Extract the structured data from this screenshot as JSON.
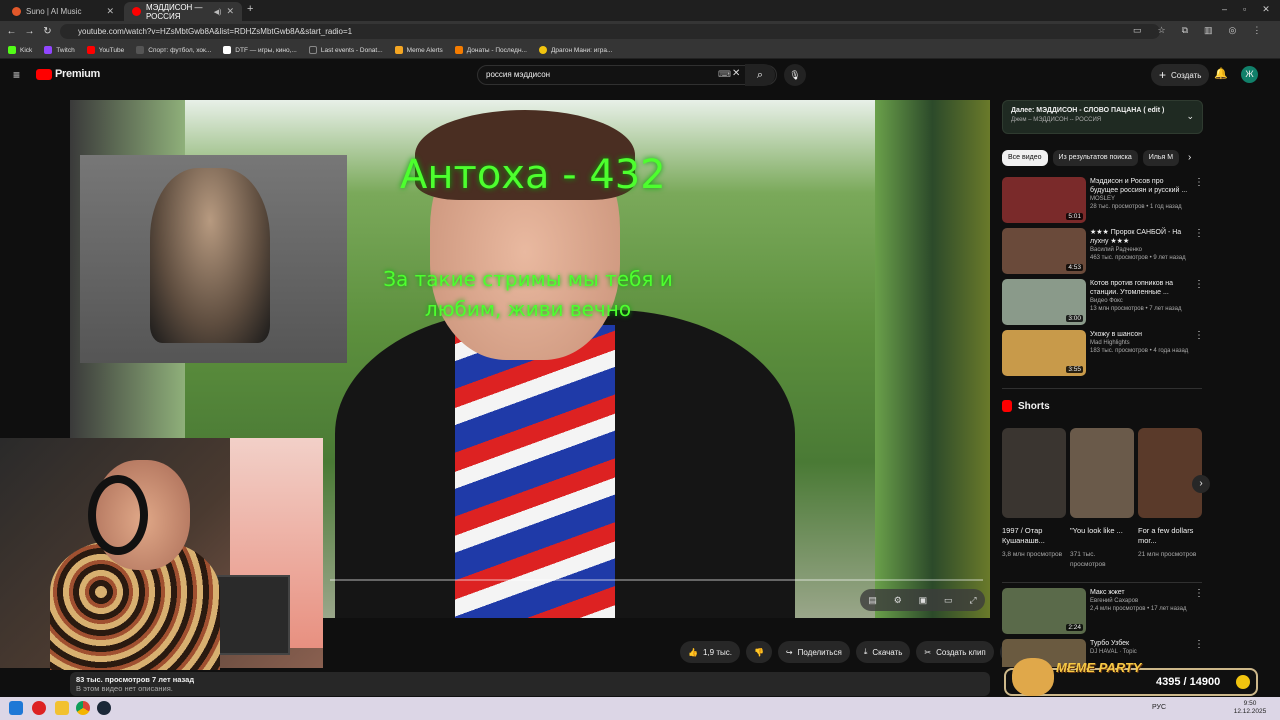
{
  "browser": {
    "tabs": [
      {
        "title": "Suno | AI Music",
        "color": "#e2582a"
      },
      {
        "title": "МЭДДИСОН — РОССИЯ",
        "color": "#ff0000"
      }
    ],
    "url": "youtube.com/watch?v=HZsMbtGwb8A&list=RDHZsMbtGwb8A&start_radio=1",
    "bookmarks": [
      {
        "label": "Kick",
        "color": "#53fc18"
      },
      {
        "label": "Twitch",
        "color": "#9146ff"
      },
      {
        "label": "YouTube",
        "color": "#ff0000"
      },
      {
        "label": "Спорт: футбол, хок...",
        "color": "#555555"
      },
      {
        "label": "DTF — игры, кино,...",
        "color": "#ffffff"
      },
      {
        "label": "Last events - Donat...",
        "color": "#333333"
      },
      {
        "label": "Meme Alerts",
        "color": "#f5a623"
      },
      {
        "label": "Донаты - Последн...",
        "color": "#f57c00"
      },
      {
        "label": "Драгон Мани: игра...",
        "color": "#f1c40f"
      }
    ]
  },
  "header": {
    "logo": "Premium",
    "search_value": "россия мэддисон",
    "create_label": "Создать",
    "avatar_letter": "Ж",
    "accent": "#ff0000"
  },
  "video": {
    "overlay_title": "Антоха - 432",
    "overlay_subtitle": "За такие стримы мы тебя и любим, живи вечно",
    "overlay_color": "#4dff2e"
  },
  "actions": {
    "likes": "1,9 тыс.",
    "share": "Поделиться",
    "download": "Скачать",
    "clip": "Создать клип"
  },
  "description": {
    "stats": "83 тыс. просмотров  7 лет назад",
    "text": "В этом видео нет описания."
  },
  "up_next": {
    "title": "Далее: МЭДДИСОН - СЛОВО ПАЦАНА ( edit )",
    "subtitle": "Джем – МЭДДИСОН -- РОССИЯ"
  },
  "chips": [
    "Все видео",
    "Из результатов поиска",
    "Илья М"
  ],
  "recommendations": [
    {
      "title": "Мэддисон и Росов про будущее россиян и русский ...",
      "channel": "MOSLEY",
      "meta": "28 тыс. просмотров • 1 год назад",
      "duration": "5:01",
      "thumb": "#7a2a2a"
    },
    {
      "title": "★★★ Пророк САНБОЙ - На лухну ★★★",
      "channel": "Василий Радченко",
      "meta": "463 тыс. просмотров • 9 лет назад",
      "duration": "4:53",
      "thumb": "#6a4a3a"
    },
    {
      "title": "Котов против гопников на станции. Утомленные ...",
      "channel": "Видео Фокс",
      "meta": "13 млн просмотров • 7 лет назад",
      "duration": "3:00",
      "thumb": "#8a9a8a"
    },
    {
      "title": "Ухожу в шансон",
      "channel": "Mad Highlights",
      "meta": "183 тыс. просмотров • 4 года назад",
      "duration": "3:55",
      "thumb": "#c89a4a"
    }
  ],
  "shorts": {
    "heading": "Shorts",
    "items": [
      {
        "title": "1997 / Отар Кушанашв...",
        "views": "3,8 млн просмотров",
        "thumb": "#3a3530"
      },
      {
        "title": "\"You look like ...",
        "views": "371 тыс. просмотров",
        "thumb": "#6a5a4a"
      },
      {
        "title": "For a few dollars mor...",
        "views": "21 млн просмотров",
        "thumb": "#5a3a2a"
      }
    ]
  },
  "more_recs": [
    {
      "title": "Макс жжет",
      "meta": "Евгений Сахаров",
      "meta2": "2,4 млн просмотров • 17 лет назад",
      "duration": "2:24",
      "thumb": "#5a6a4a"
    },
    {
      "title": "Турбо Узбек",
      "meta": "DJ HAVAL · Topic",
      "meta2": "",
      "duration": "",
      "thumb": "#6a5a40"
    }
  ],
  "meme": {
    "label": "MEME PARTY",
    "counter": "4395 / 14900"
  },
  "taskbar": {
    "lang": "РУС",
    "time": "9:50",
    "date": "12.12.2025"
  }
}
